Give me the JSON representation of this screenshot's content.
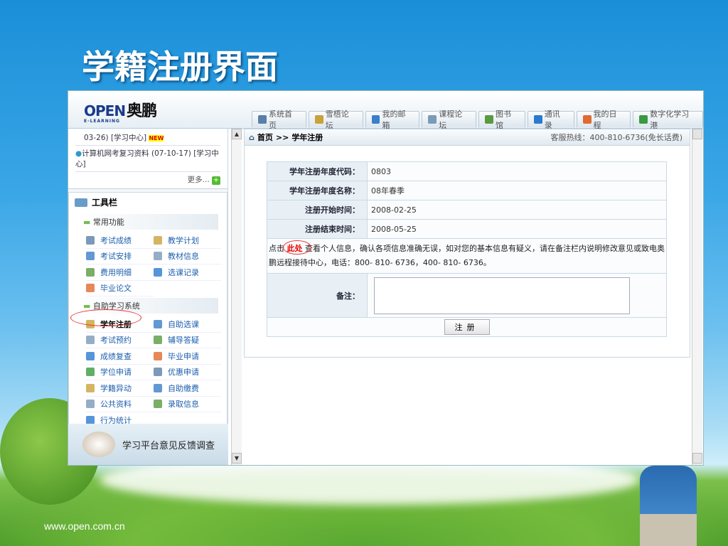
{
  "slide": {
    "title": "学籍注册界面",
    "footer": "www.open.com.cn"
  },
  "header": {
    "logo": "OPEN",
    "logo_cn": "奥鹏",
    "logo_sub": "E-LEARNING",
    "tabs": [
      {
        "label": "系统首页",
        "icon": "home-icon"
      },
      {
        "label": "雪梧论坛",
        "icon": "forum-icon"
      },
      {
        "label": "我的邮箱",
        "icon": "mail-icon"
      },
      {
        "label": "课程论坛",
        "icon": "forum-icon"
      },
      {
        "label": "图书馆",
        "icon": "book-icon"
      },
      {
        "label": "通讯录",
        "icon": "contact-icon"
      },
      {
        "label": "我的日程",
        "icon": "calendar-icon"
      },
      {
        "label": "数字化学习港",
        "icon": "user-icon"
      }
    ]
  },
  "sidebar": {
    "news": [
      "03-26) [学习中心]",
      "计算机网考复习资料 (07-10-17) [学习中心]"
    ],
    "new_badge": "NEW",
    "more": "更多...",
    "toolbox_title": "工具栏",
    "sections": [
      {
        "title": "常用功能",
        "items": [
          "考试成绩",
          "教学计划",
          "考试安排",
          "教材信息",
          "费用明细",
          "选课记录",
          "毕业论文"
        ]
      },
      {
        "title": "自助学习系统",
        "items": [
          "学年注册",
          "自助选课",
          "考试预约",
          "辅导答疑",
          "成绩复查",
          "毕业申请",
          "学位申请",
          "优惠申请",
          "学籍异动",
          "自助缴费",
          "公共资料",
          "录取信息",
          "行为统计"
        ]
      }
    ],
    "feedback": "学习平台意见反馈调查"
  },
  "main": {
    "breadcrumb_home": "首页",
    "breadcrumb_sep": ">>",
    "breadcrumb_current": "学年注册",
    "hotline": "客服热线：400-810-6736(免长话费)",
    "fields": [
      {
        "label": "学年注册年度代码：",
        "value": "0803"
      },
      {
        "label": "学年注册年度名称：",
        "value": "08年春季"
      },
      {
        "label": "注册开始时间：",
        "value": "2008-02-25"
      },
      {
        "label": "注册结束时间：",
        "value": "2008-05-25"
      }
    ],
    "note_prefix": "点击",
    "note_link": "此处",
    "note_text": "查看个人信息，确认各项信息准确无误，如对您的基本信息有疑义，请在备注栏内说明修改意见或致电奥鹏远程接待中心，电话：800- 810- 6736，400- 810- 6736。",
    "remark_label": "备注：",
    "remark_value": "",
    "submit": "注册"
  }
}
